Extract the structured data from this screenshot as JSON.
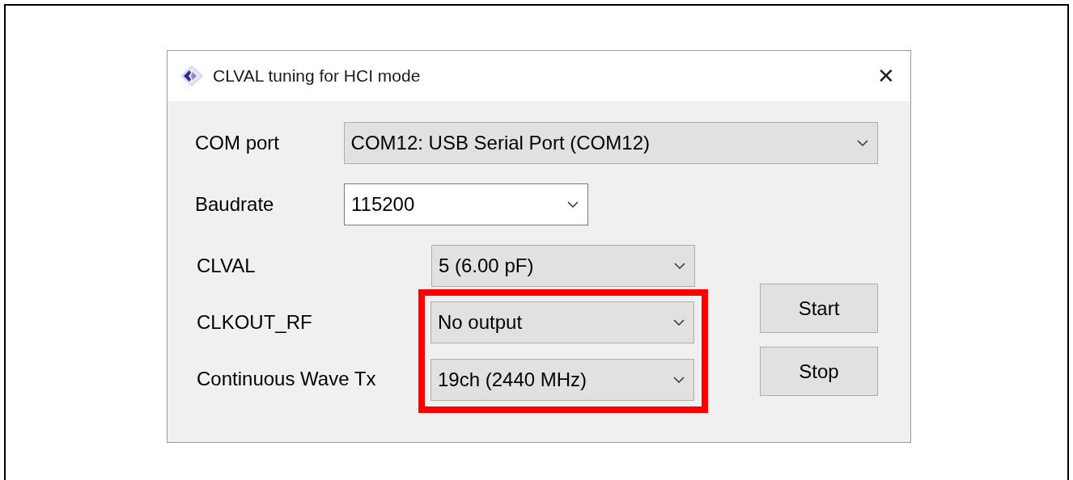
{
  "window": {
    "title": "CLVAL tuning for HCI mode",
    "close": "✕"
  },
  "port_settings": [
    {
      "label": "COM port",
      "value": "COM12: USB Serial Port (COM12)",
      "kind": "dropdown"
    },
    {
      "label": "Baudrate",
      "value": "115200",
      "kind": "editable"
    }
  ],
  "test_settings": [
    {
      "label": "CLVAL",
      "value": "5 (6.00 pF)",
      "highlighted": false
    },
    {
      "label": "CLKOUT_RF",
      "value": "No output",
      "highlighted": true
    },
    {
      "label": "Continuous Wave Tx",
      "value": "19ch (2440 MHz)",
      "highlighted": true
    }
  ],
  "buttons": [
    "Start",
    "Stop"
  ]
}
